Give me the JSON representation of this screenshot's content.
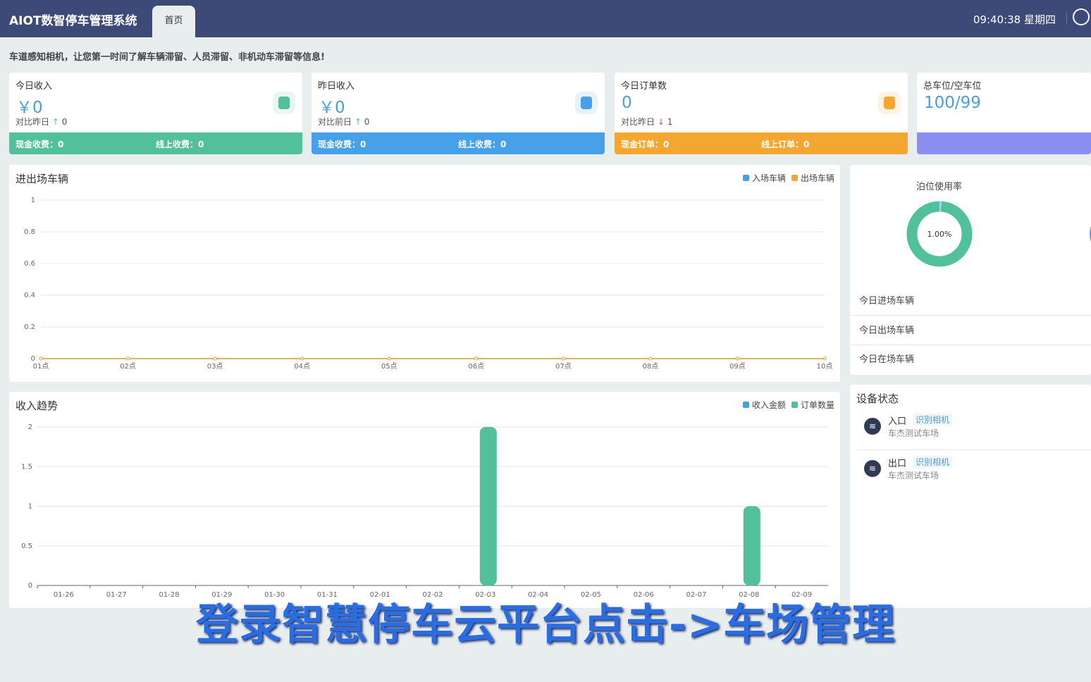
{
  "header": {
    "title": "AIOT数智停车管理系统",
    "tab": "首页",
    "clock": "09:40:38 星期四"
  },
  "notice": "车道感知相机，让您第一时间了解车辆滞留、人员滞留、非机动车滞留等信息!",
  "cards": [
    {
      "title": "今日收入",
      "value": "￥0",
      "compare": "对比昨日",
      "arrow": "↑",
      "delta": "0",
      "left": "现金收费：0",
      "right": "线上收费：0",
      "color": "#52c09a",
      "icon": "money-bag-icon"
    },
    {
      "title": "昨日收入",
      "value": "￥0",
      "compare": "对比前日",
      "arrow": "↑",
      "delta": "0",
      "left": "现金收费：0",
      "right": "线上收费：0",
      "color": "#46a1e8",
      "icon": "wallet-icon"
    },
    {
      "title": "今日订单数",
      "value": "0",
      "compare": "对比昨日",
      "arrow": "↓",
      "delta": "1",
      "left": "现金订单：0",
      "right": "线上订单：0",
      "color": "#f4a730",
      "icon": "clipboard-icon"
    },
    {
      "title": "总车位/空车位",
      "value": "100/99",
      "color": "#8b8ff2"
    }
  ],
  "traffic": {
    "title": "进出场车辆",
    "legend": [
      "入场车辆",
      "出场车辆"
    ]
  },
  "income": {
    "title": "收入趋势",
    "legend": [
      "收入金额",
      "订单数量"
    ]
  },
  "usage": {
    "title": "泊位使用率",
    "percent": "1.00%",
    "rows": [
      "今日进场车辆",
      "今日出场车辆",
      "今日在场车辆"
    ]
  },
  "devices": {
    "title": "设备状态",
    "items": [
      {
        "name": "入口",
        "tag": "识别相机",
        "site": "车杰测试车场"
      },
      {
        "name": "出口",
        "tag": "识别相机",
        "site": "车杰测试车场"
      }
    ]
  },
  "caption": "登录智慧停车云平台点击->车场管理",
  "chart_data": [
    {
      "type": "line",
      "categories": [
        "01点",
        "02点",
        "03点",
        "04点",
        "05点",
        "06点",
        "07点",
        "08点",
        "09点",
        "10点"
      ],
      "ylim": [
        0,
        1
      ],
      "yticks": [
        "0",
        "0.2",
        "0.4",
        "0.6",
        "0.8",
        "1"
      ],
      "series": [
        {
          "name": "入场车辆",
          "color": "#4a9fd8",
          "values": [
            0,
            0,
            0,
            0,
            0,
            0,
            0,
            0,
            0,
            0
          ]
        },
        {
          "name": "出场车辆",
          "color": "#f4a730",
          "values": [
            0,
            0,
            0,
            0,
            0,
            0,
            0,
            0,
            0,
            0
          ]
        }
      ]
    },
    {
      "type": "bar",
      "categories": [
        "01-26",
        "01-27",
        "01-28",
        "01-29",
        "01-30",
        "01-31",
        "02-01",
        "02-02",
        "02-03",
        "02-04",
        "02-05",
        "02-06",
        "02-07",
        "02-08",
        "02-09"
      ],
      "ylim": [
        0,
        2
      ],
      "yticks": [
        "0",
        "0.5",
        "1",
        "1.5",
        "2"
      ],
      "series": [
        {
          "name": "收入金额",
          "color": "#4a9fd8",
          "values": [
            0,
            0,
            0,
            0,
            0,
            0,
            0,
            0,
            0,
            0,
            0,
            0,
            0,
            0,
            0
          ]
        },
        {
          "name": "订单数量",
          "color": "#52c09a",
          "values": [
            0,
            0,
            0,
            0,
            0,
            0,
            0,
            0,
            2,
            0,
            0,
            0,
            0,
            1,
            0
          ]
        }
      ]
    }
  ]
}
